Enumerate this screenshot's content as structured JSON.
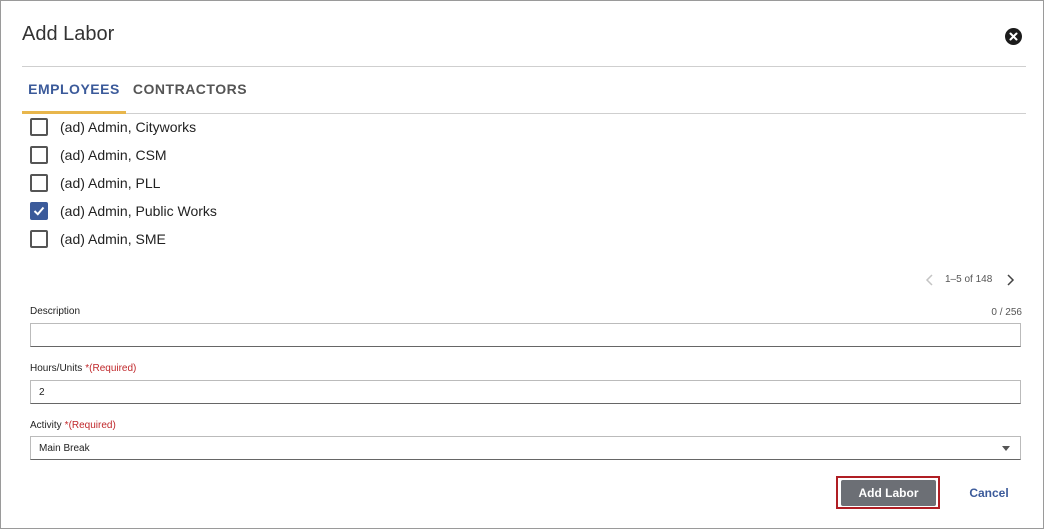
{
  "dialog": {
    "title": "Add Labor"
  },
  "tabs": [
    {
      "label": "EMPLOYEES",
      "active": true
    },
    {
      "label": "CONTRACTORS",
      "active": false
    }
  ],
  "employees": [
    {
      "name": "(ad) Admin, Cityworks",
      "checked": false
    },
    {
      "name": "(ad) Admin, CSM",
      "checked": false
    },
    {
      "name": "(ad) Admin, PLL",
      "checked": false
    },
    {
      "name": "(ad) Admin, Public Works",
      "checked": true
    },
    {
      "name": "(ad) Admin, SME",
      "checked": false
    }
  ],
  "pagination": {
    "text": "1–5 of 148"
  },
  "form": {
    "description": {
      "label": "Description",
      "value": "",
      "counter": "0 / 256"
    },
    "hours": {
      "label": "Hours/Units",
      "required": "*(Required)",
      "value": "2"
    },
    "activity": {
      "label": "Activity",
      "required": "*(Required)",
      "value": "Main Break"
    }
  },
  "actions": {
    "add_label": "Add Labor",
    "cancel_label": "Cancel"
  },
  "colors": {
    "accent": "#3b5a9a",
    "tab_indicator": "#e8b64c",
    "required": "#c0282b",
    "primary_button": "#6c6f75",
    "highlight_outline": "#b01e24"
  }
}
